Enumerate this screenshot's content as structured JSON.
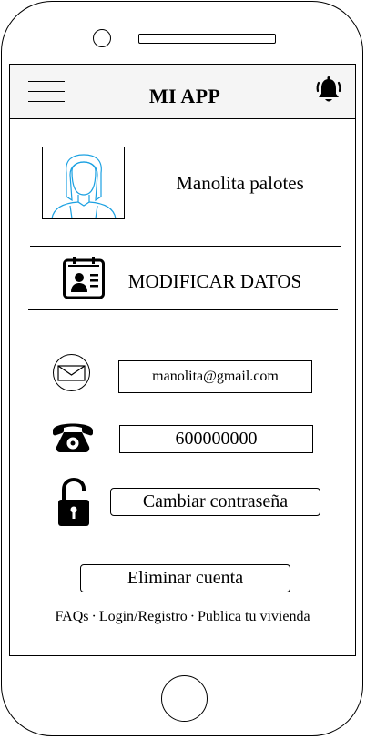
{
  "header": {
    "title": "MI APP",
    "menu_icon": "hamburger-menu-icon",
    "notification_icon": "bell-icon"
  },
  "profile": {
    "avatar_icon": "user-avatar-icon",
    "name": "Manolita palotes"
  },
  "modify": {
    "icon": "contact-card-icon",
    "label": "MODIFICAR DATOS"
  },
  "contact": {
    "email_icon": "envelope-icon",
    "email_value": "manolita@gmail.com",
    "phone_icon": "telephone-icon",
    "phone_value": "600000000",
    "lock_icon": "unlocked-padlock-icon",
    "change_password_label": "Cambiar contraseña"
  },
  "actions": {
    "delete_account_label": "Eliminar cuenta"
  },
  "footer": {
    "links": [
      "FAQs",
      "Login/Registro",
      "Publica tu vivienda"
    ],
    "separator": "·"
  },
  "colors": {
    "header_bg": "#f5f5f5",
    "avatar_line": "#1ba1e2",
    "border": "#000000"
  }
}
